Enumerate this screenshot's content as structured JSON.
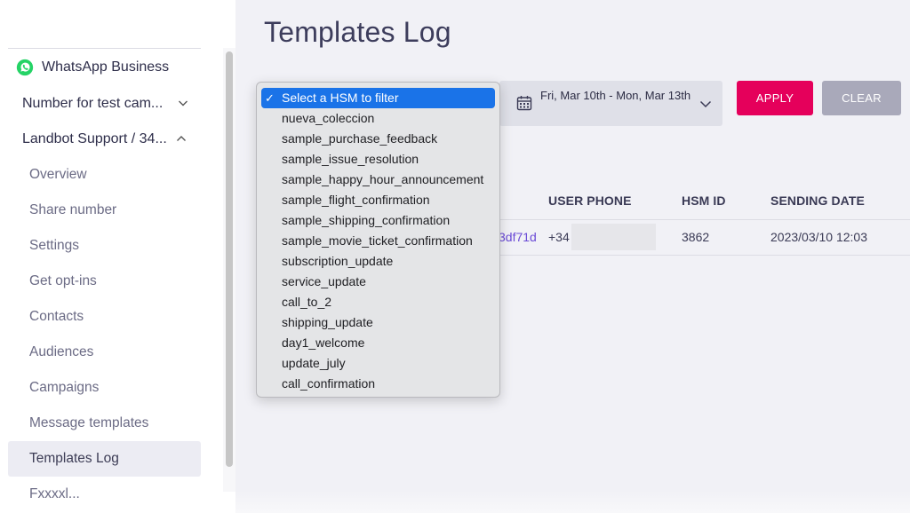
{
  "sidebar": {
    "workspace": "WhatsApp Business",
    "channels": [
      {
        "label": "Number for test cam...",
        "expanded": false
      },
      {
        "label": "Landbot Support / 34...",
        "expanded": true
      }
    ],
    "sub_items": [
      {
        "label": "Overview"
      },
      {
        "label": "Share number"
      },
      {
        "label": "Settings"
      },
      {
        "label": "Get opt-ins"
      },
      {
        "label": "Contacts"
      },
      {
        "label": "Audiences"
      },
      {
        "label": "Campaigns"
      },
      {
        "label": "Message templates"
      },
      {
        "label": "Templates Log",
        "active": true
      },
      {
        "label": "Fxxxxl..."
      }
    ]
  },
  "page": {
    "title": "Templates Log"
  },
  "filters": {
    "date_range": "Fri, Mar 10th - Mon, Mar 13th",
    "apply_label": "APPLY",
    "clear_label": "CLEAR"
  },
  "dropdown": {
    "options": [
      {
        "label": "Select a HSM to filter",
        "selected": true
      },
      {
        "label": "nueva_coleccion"
      },
      {
        "label": "sample_purchase_feedback"
      },
      {
        "label": "sample_issue_resolution"
      },
      {
        "label": "sample_happy_hour_announcement"
      },
      {
        "label": "sample_flight_confirmation"
      },
      {
        "label": "sample_shipping_confirmation"
      },
      {
        "label": "sample_movie_ticket_confirmation"
      },
      {
        "label": "subscription_update"
      },
      {
        "label": "service_update"
      },
      {
        "label": "call_to_2"
      },
      {
        "label": "shipping_update"
      },
      {
        "label": "day1_welcome"
      },
      {
        "label": "update_july"
      },
      {
        "label": "call_confirmation"
      }
    ],
    "check_glyph": "✓"
  },
  "table": {
    "headers": [
      "USER PHONE",
      "HSM ID",
      "SENDING DATE"
    ],
    "rows": [
      {
        "id_fragment": "3df71d",
        "user_phone": "+34",
        "hsm_id": "3862",
        "sending_date": "2023/03/10 12:03"
      }
    ]
  },
  "colors": {
    "accent": "#e5005b",
    "clear_button": "#a9a9ba",
    "selected_option": "#1a73e8",
    "link": "#6a4ad6"
  },
  "icons": {
    "workspace": "whatsapp-icon",
    "date": "calendar-icon",
    "expand": "chevron-down-icon",
    "collapse": "chevron-up-icon"
  }
}
